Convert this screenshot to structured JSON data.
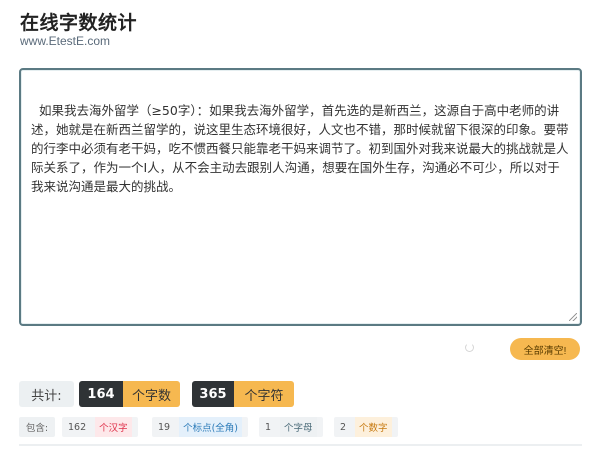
{
  "header": {
    "title": "在线字数统计",
    "subtitle": "www.EtestE.com"
  },
  "editor": {
    "text": "如果我去海外留学（≥50字）：如果我去海外留学，首先选的是新西兰，这源自于高中老师的讲述，她就是在新西兰留学的，说这里生态环境很好，人文也不错，那时候就留下很深的印象。要带的行李中必须有老干妈，吃不惯西餐只能靠老干妈来调节了。初到国外对我来说最大的挑战就是人际关系了，作为一个I人，从不会主动去跟别人沟通，想要在国外生存，沟通必不可少，所以对于我来说沟通是最大的挑战。"
  },
  "actions": {
    "clear_label": "全部清空!"
  },
  "summary": {
    "label": "共计:",
    "char_count": "164",
    "char_unit": "个字数",
    "symbol_count": "365",
    "symbol_unit": "个字符"
  },
  "details": {
    "label": "包含:",
    "items": [
      {
        "count": "162",
        "unit": "个汉字",
        "color": "#e0304a"
      },
      {
        "count": "19",
        "unit": "个标点(全角)",
        "color": "#2a7ab8"
      },
      {
        "count": "1",
        "unit": "个字母",
        "color": "#4a6a78"
      },
      {
        "count": "2",
        "unit": "个数字",
        "color": "#c77a10"
      }
    ]
  }
}
